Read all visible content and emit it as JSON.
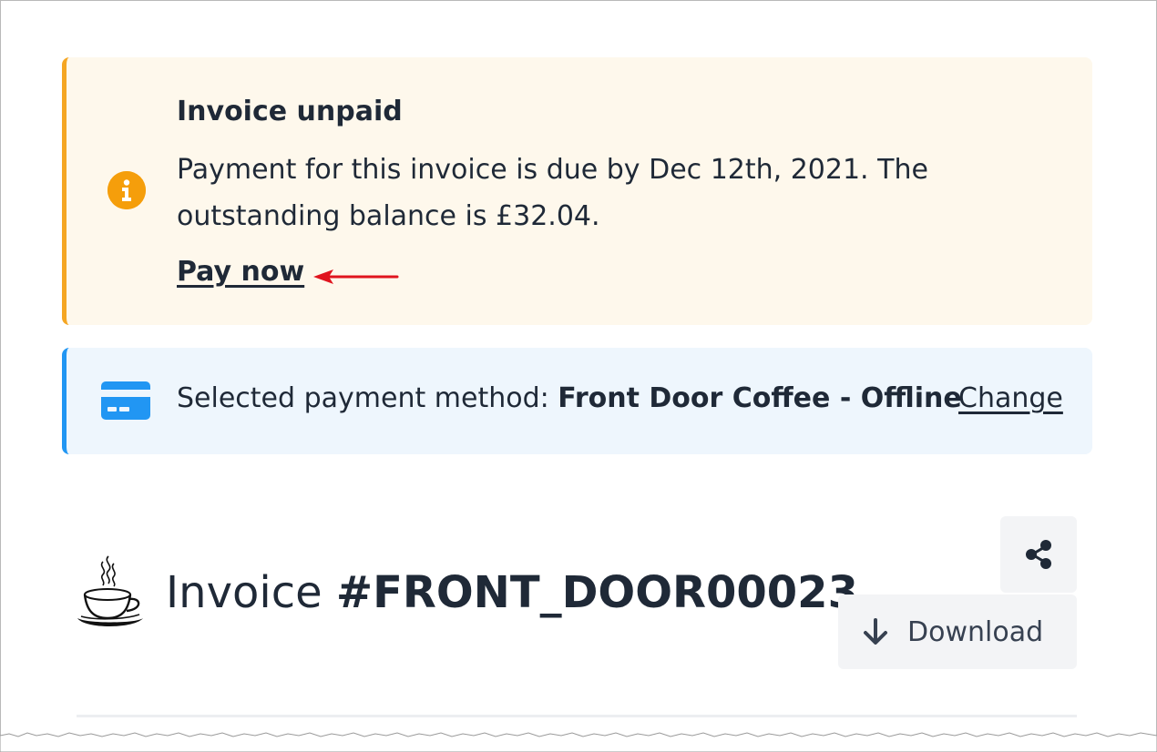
{
  "alert_unpaid": {
    "title": "Invoice unpaid",
    "body": "Payment for this invoice is due by Dec 12th, 2021. The outstanding balance is £32.04.",
    "pay_link": "Pay now",
    "accent_color": "#f5a623",
    "background_color": "#fef8ec",
    "icon": "info-circle-icon"
  },
  "payment_method": {
    "label": "Selected payment method: ",
    "value": "Front Door Coffee - Offline",
    "change_link": "Change",
    "accent_color": "#2196f3",
    "background_color": "#eef6fd",
    "icon": "credit-card-icon"
  },
  "invoice": {
    "heading_prefix": "Invoice ",
    "number": "#FRONT_DOOR00023",
    "logo": "coffee-cup-logo"
  },
  "actions": {
    "share_icon": "share-icon",
    "download_label": "Download",
    "download_icon": "arrow-down-icon"
  },
  "annotation": {
    "arrow_color": "#e0141e"
  }
}
